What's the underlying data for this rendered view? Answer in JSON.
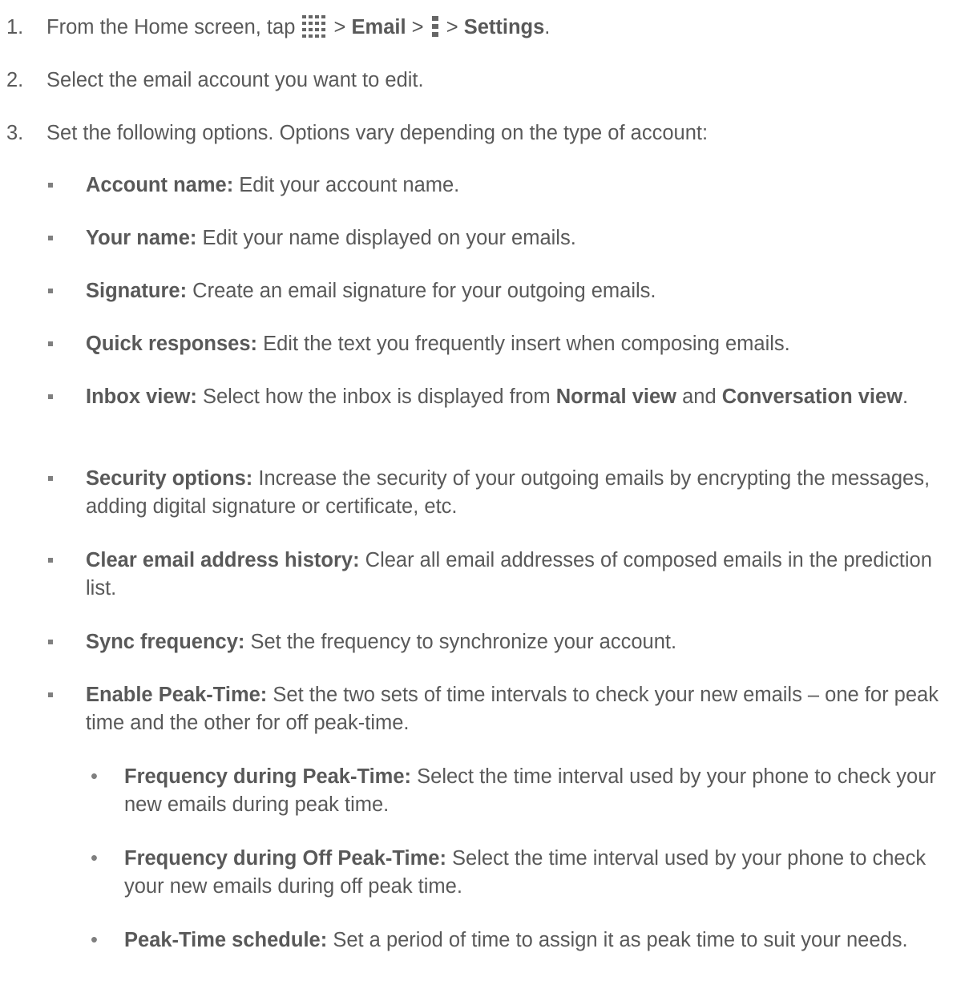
{
  "steps": [
    {
      "num": "1.",
      "text_before": "From the Home screen, tap",
      "sep1": " > ",
      "email": "Email",
      "sep2": " > ",
      "sep3": " > ",
      "settings": "Settings",
      "end": "."
    },
    {
      "num": "2.",
      "text": "Select the email account you want to edit."
    },
    {
      "num": "3.",
      "text": "Set the following options. Options vary depending on the type of account:"
    }
  ],
  "icons": {
    "apps": "apps-grid-icon",
    "menu": "menu-icon"
  },
  "options": [
    {
      "term": "Account name:",
      "desc": " Edit your account name."
    },
    {
      "term": "Your name:",
      "desc": " Edit your name displayed on your emails."
    },
    {
      "term": "Signature:",
      "desc": " Create an email signature for your outgoing emails."
    },
    {
      "term": "Quick responses:",
      "desc": " Edit the text you frequently insert when composing emails."
    },
    {
      "term": "Inbox view:",
      "desc": " Select how the inbox is displayed from ",
      "b1": "Normal view",
      "mid": " and ",
      "b2": "Conversation view",
      "end": "."
    },
    {
      "term": "Security options:",
      "desc": " Increase the security of your outgoing emails by encrypting the messages, adding digital signature or certificate, etc."
    },
    {
      "term": "Clear email address history:",
      "desc": " Clear all email addresses of composed emails in the prediction list."
    },
    {
      "term": "Sync frequency:",
      "desc": " Set the frequency to synchronize your account."
    },
    {
      "term": "Enable Peak-Time:",
      "desc": " Set the two sets of time intervals to check your new emails – one for peak time and the other for off peak-time."
    }
  ],
  "sub_options": [
    {
      "term": "Frequency during Peak-Time:",
      "desc": " Select the time interval used by your phone to check your new emails during peak time."
    },
    {
      "term": "Frequency during Off Peak-Time:",
      "desc": " Select the time interval used by your phone to check your new emails during off peak time."
    },
    {
      "term": "Peak-Time schedule:",
      "desc": " Set a period of time to assign it as peak time to suit your needs."
    }
  ],
  "sub_bullet": "•"
}
